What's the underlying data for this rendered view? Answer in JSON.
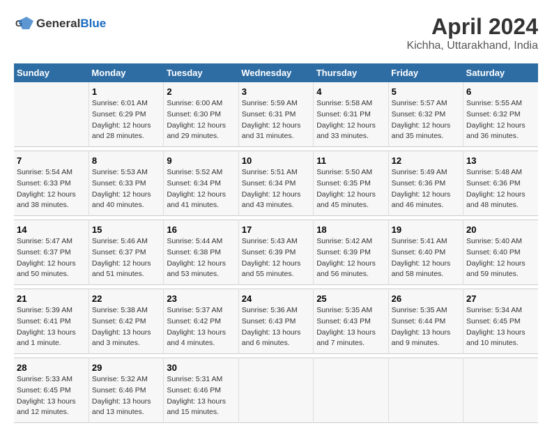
{
  "header": {
    "logo_general": "General",
    "logo_blue": "Blue",
    "title": "April 2024",
    "subtitle": "Kichha, Uttarakhand, India"
  },
  "calendar": {
    "columns": [
      "Sunday",
      "Monday",
      "Tuesday",
      "Wednesday",
      "Thursday",
      "Friday",
      "Saturday"
    ],
    "weeks": [
      [
        {
          "day": "",
          "info": ""
        },
        {
          "day": "1",
          "info": "Sunrise: 6:01 AM\nSunset: 6:29 PM\nDaylight: 12 hours\nand 28 minutes."
        },
        {
          "day": "2",
          "info": "Sunrise: 6:00 AM\nSunset: 6:30 PM\nDaylight: 12 hours\nand 29 minutes."
        },
        {
          "day": "3",
          "info": "Sunrise: 5:59 AM\nSunset: 6:31 PM\nDaylight: 12 hours\nand 31 minutes."
        },
        {
          "day": "4",
          "info": "Sunrise: 5:58 AM\nSunset: 6:31 PM\nDaylight: 12 hours\nand 33 minutes."
        },
        {
          "day": "5",
          "info": "Sunrise: 5:57 AM\nSunset: 6:32 PM\nDaylight: 12 hours\nand 35 minutes."
        },
        {
          "day": "6",
          "info": "Sunrise: 5:55 AM\nSunset: 6:32 PM\nDaylight: 12 hours\nand 36 minutes."
        }
      ],
      [
        {
          "day": "7",
          "info": "Sunrise: 5:54 AM\nSunset: 6:33 PM\nDaylight: 12 hours\nand 38 minutes."
        },
        {
          "day": "8",
          "info": "Sunrise: 5:53 AM\nSunset: 6:33 PM\nDaylight: 12 hours\nand 40 minutes."
        },
        {
          "day": "9",
          "info": "Sunrise: 5:52 AM\nSunset: 6:34 PM\nDaylight: 12 hours\nand 41 minutes."
        },
        {
          "day": "10",
          "info": "Sunrise: 5:51 AM\nSunset: 6:34 PM\nDaylight: 12 hours\nand 43 minutes."
        },
        {
          "day": "11",
          "info": "Sunrise: 5:50 AM\nSunset: 6:35 PM\nDaylight: 12 hours\nand 45 minutes."
        },
        {
          "day": "12",
          "info": "Sunrise: 5:49 AM\nSunset: 6:36 PM\nDaylight: 12 hours\nand 46 minutes."
        },
        {
          "day": "13",
          "info": "Sunrise: 5:48 AM\nSunset: 6:36 PM\nDaylight: 12 hours\nand 48 minutes."
        }
      ],
      [
        {
          "day": "14",
          "info": "Sunrise: 5:47 AM\nSunset: 6:37 PM\nDaylight: 12 hours\nand 50 minutes."
        },
        {
          "day": "15",
          "info": "Sunrise: 5:46 AM\nSunset: 6:37 PM\nDaylight: 12 hours\nand 51 minutes."
        },
        {
          "day": "16",
          "info": "Sunrise: 5:44 AM\nSunset: 6:38 PM\nDaylight: 12 hours\nand 53 minutes."
        },
        {
          "day": "17",
          "info": "Sunrise: 5:43 AM\nSunset: 6:39 PM\nDaylight: 12 hours\nand 55 minutes."
        },
        {
          "day": "18",
          "info": "Sunrise: 5:42 AM\nSunset: 6:39 PM\nDaylight: 12 hours\nand 56 minutes."
        },
        {
          "day": "19",
          "info": "Sunrise: 5:41 AM\nSunset: 6:40 PM\nDaylight: 12 hours\nand 58 minutes."
        },
        {
          "day": "20",
          "info": "Sunrise: 5:40 AM\nSunset: 6:40 PM\nDaylight: 12 hours\nand 59 minutes."
        }
      ],
      [
        {
          "day": "21",
          "info": "Sunrise: 5:39 AM\nSunset: 6:41 PM\nDaylight: 13 hours\nand 1 minute."
        },
        {
          "day": "22",
          "info": "Sunrise: 5:38 AM\nSunset: 6:42 PM\nDaylight: 13 hours\nand 3 minutes."
        },
        {
          "day": "23",
          "info": "Sunrise: 5:37 AM\nSunset: 6:42 PM\nDaylight: 13 hours\nand 4 minutes."
        },
        {
          "day": "24",
          "info": "Sunrise: 5:36 AM\nSunset: 6:43 PM\nDaylight: 13 hours\nand 6 minutes."
        },
        {
          "day": "25",
          "info": "Sunrise: 5:35 AM\nSunset: 6:43 PM\nDaylight: 13 hours\nand 7 minutes."
        },
        {
          "day": "26",
          "info": "Sunrise: 5:35 AM\nSunset: 6:44 PM\nDaylight: 13 hours\nand 9 minutes."
        },
        {
          "day": "27",
          "info": "Sunrise: 5:34 AM\nSunset: 6:45 PM\nDaylight: 13 hours\nand 10 minutes."
        }
      ],
      [
        {
          "day": "28",
          "info": "Sunrise: 5:33 AM\nSunset: 6:45 PM\nDaylight: 13 hours\nand 12 minutes."
        },
        {
          "day": "29",
          "info": "Sunrise: 5:32 AM\nSunset: 6:46 PM\nDaylight: 13 hours\nand 13 minutes."
        },
        {
          "day": "30",
          "info": "Sunrise: 5:31 AM\nSunset: 6:46 PM\nDaylight: 13 hours\nand 15 minutes."
        },
        {
          "day": "",
          "info": ""
        },
        {
          "day": "",
          "info": ""
        },
        {
          "day": "",
          "info": ""
        },
        {
          "day": "",
          "info": ""
        }
      ]
    ]
  }
}
